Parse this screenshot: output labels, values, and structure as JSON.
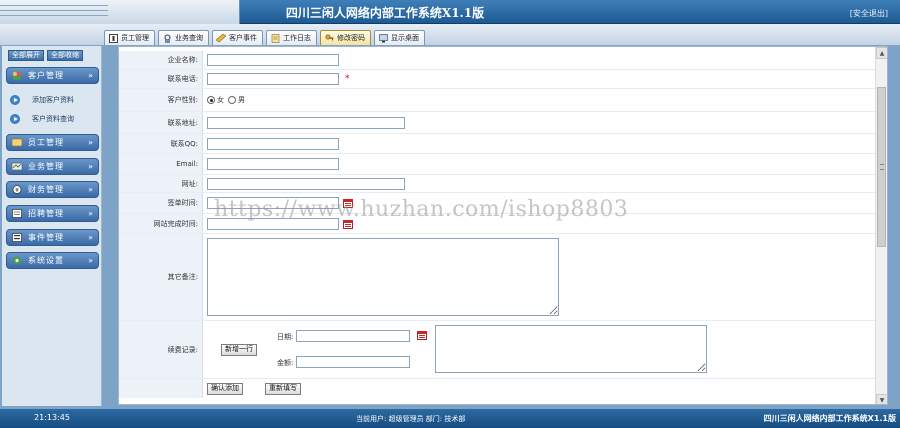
{
  "header": {
    "title": "四川三闲人网络内部工作系统X1.1版",
    "logout": "[安全退出]"
  },
  "tabs": [
    {
      "label": "员工管理",
      "icon": "employee-icon"
    },
    {
      "label": "业务查询",
      "icon": "search-icon"
    },
    {
      "label": "客户事件",
      "icon": "pencil-icon"
    },
    {
      "label": "工作日志",
      "icon": "log-icon"
    },
    {
      "label": "修改密码",
      "icon": "key-icon"
    },
    {
      "label": "显示桌面",
      "icon": "desktop-icon"
    }
  ],
  "sidebar": {
    "expand_all": "全部展开",
    "collapse_all": "全部收缩",
    "menus": [
      {
        "label": "客户管理",
        "icon": "customer-icon"
      },
      {
        "label": "员工管理",
        "icon": "staff-icon"
      },
      {
        "label": "业务管理",
        "icon": "business-icon"
      },
      {
        "label": "财务管理",
        "icon": "finance-icon"
      },
      {
        "label": "招聘管理",
        "icon": "recruit-icon"
      },
      {
        "label": "事件管理",
        "icon": "event-icon"
      },
      {
        "label": "系统设置",
        "icon": "settings-icon"
      }
    ],
    "subitems": [
      "添加客户资料",
      "客户资料查询"
    ]
  },
  "form": {
    "company_name": {
      "label": "企业名称:",
      "value": ""
    },
    "phone": {
      "label": "联系电话:",
      "value": "",
      "required_mark": "*"
    },
    "gender": {
      "label": "客户性别:",
      "options": [
        "女",
        "男"
      ],
      "selected": "女"
    },
    "address": {
      "label": "联系地址:",
      "value": ""
    },
    "qq": {
      "label": "联系QQ:",
      "value": ""
    },
    "email": {
      "label": "Email:",
      "value": ""
    },
    "website": {
      "label": "网址:",
      "value": ""
    },
    "sign_date": {
      "label": "签单时间:",
      "value": ""
    },
    "finish_date": {
      "label": "网站完成时间:",
      "value": ""
    },
    "remarks": {
      "label": "其它备注:",
      "value": ""
    },
    "renewal": {
      "label": "续费记录:",
      "new_row_button": "新增一行",
      "date_label": "日期:",
      "amount_label": "金额:"
    },
    "submit_button": "确认添加",
    "reset_button": "重新填写"
  },
  "footer": {
    "time": "21:13:45",
    "user": "当前用户: 超级管理员   部门: 技术部",
    "system_name": "四川三闲人网络内部工作系统X1.1版"
  },
  "watermark": "https://www.huzhan.com/ishop8803"
}
